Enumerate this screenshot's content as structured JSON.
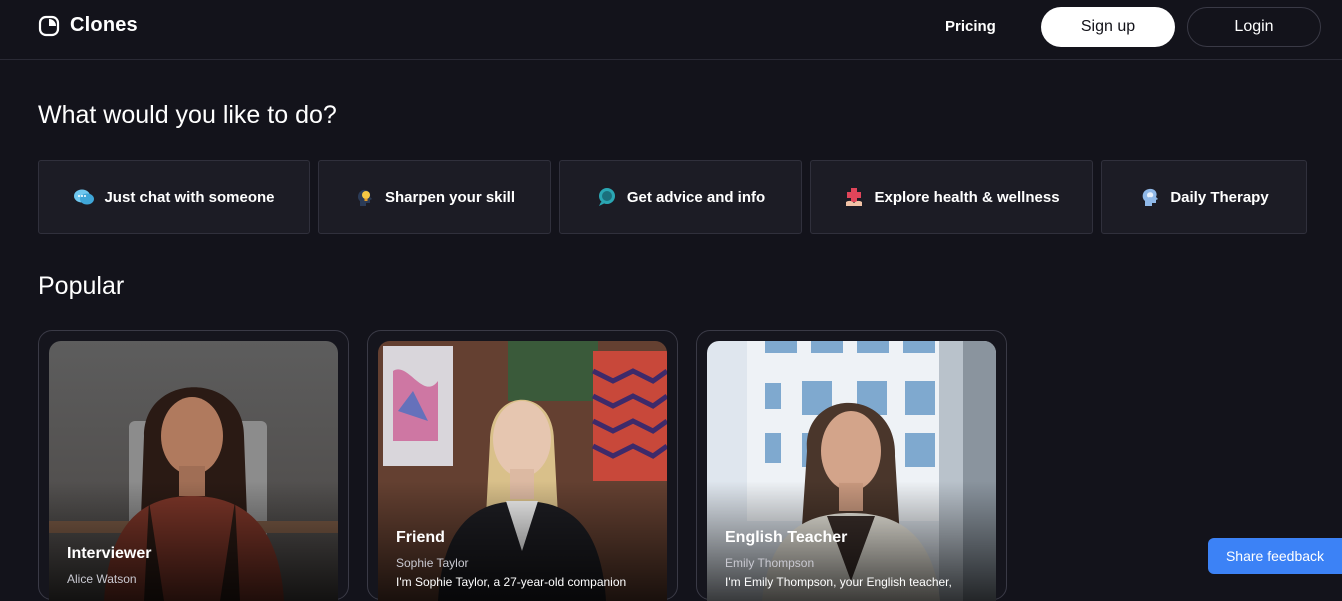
{
  "header": {
    "logo_text": "Clones",
    "nav_pricing": "Pricing",
    "signup_label": "Sign up",
    "login_label": "Login"
  },
  "main": {
    "question_heading": "What would you like to do?",
    "popular_heading": "Popular",
    "actions": [
      {
        "label": "Just chat with someone",
        "icon": "chat-bubbles-icon"
      },
      {
        "label": "Sharpen your skill",
        "icon": "lightbulb-head-icon"
      },
      {
        "label": "Get advice and info",
        "icon": "speech-bubble-icon"
      },
      {
        "label": "Explore health & wellness",
        "icon": "health-cross-icon"
      },
      {
        "label": "Daily Therapy",
        "icon": "brain-head-icon"
      }
    ],
    "cards": [
      {
        "title": "Interviewer",
        "name": "Alice Watson",
        "desc": ""
      },
      {
        "title": "Friend",
        "name": "Sophie Taylor",
        "desc": "I'm Sophie Taylor, a 27-year-old companion"
      },
      {
        "title": "English Teacher",
        "name": "Emily Thompson",
        "desc": "I'm Emily Thompson, your English teacher,"
      }
    ]
  },
  "feedback_label": "Share feedback",
  "colors": {
    "background": "#13131b",
    "tile": "#1c1c25",
    "accent": "#3c82f6"
  }
}
